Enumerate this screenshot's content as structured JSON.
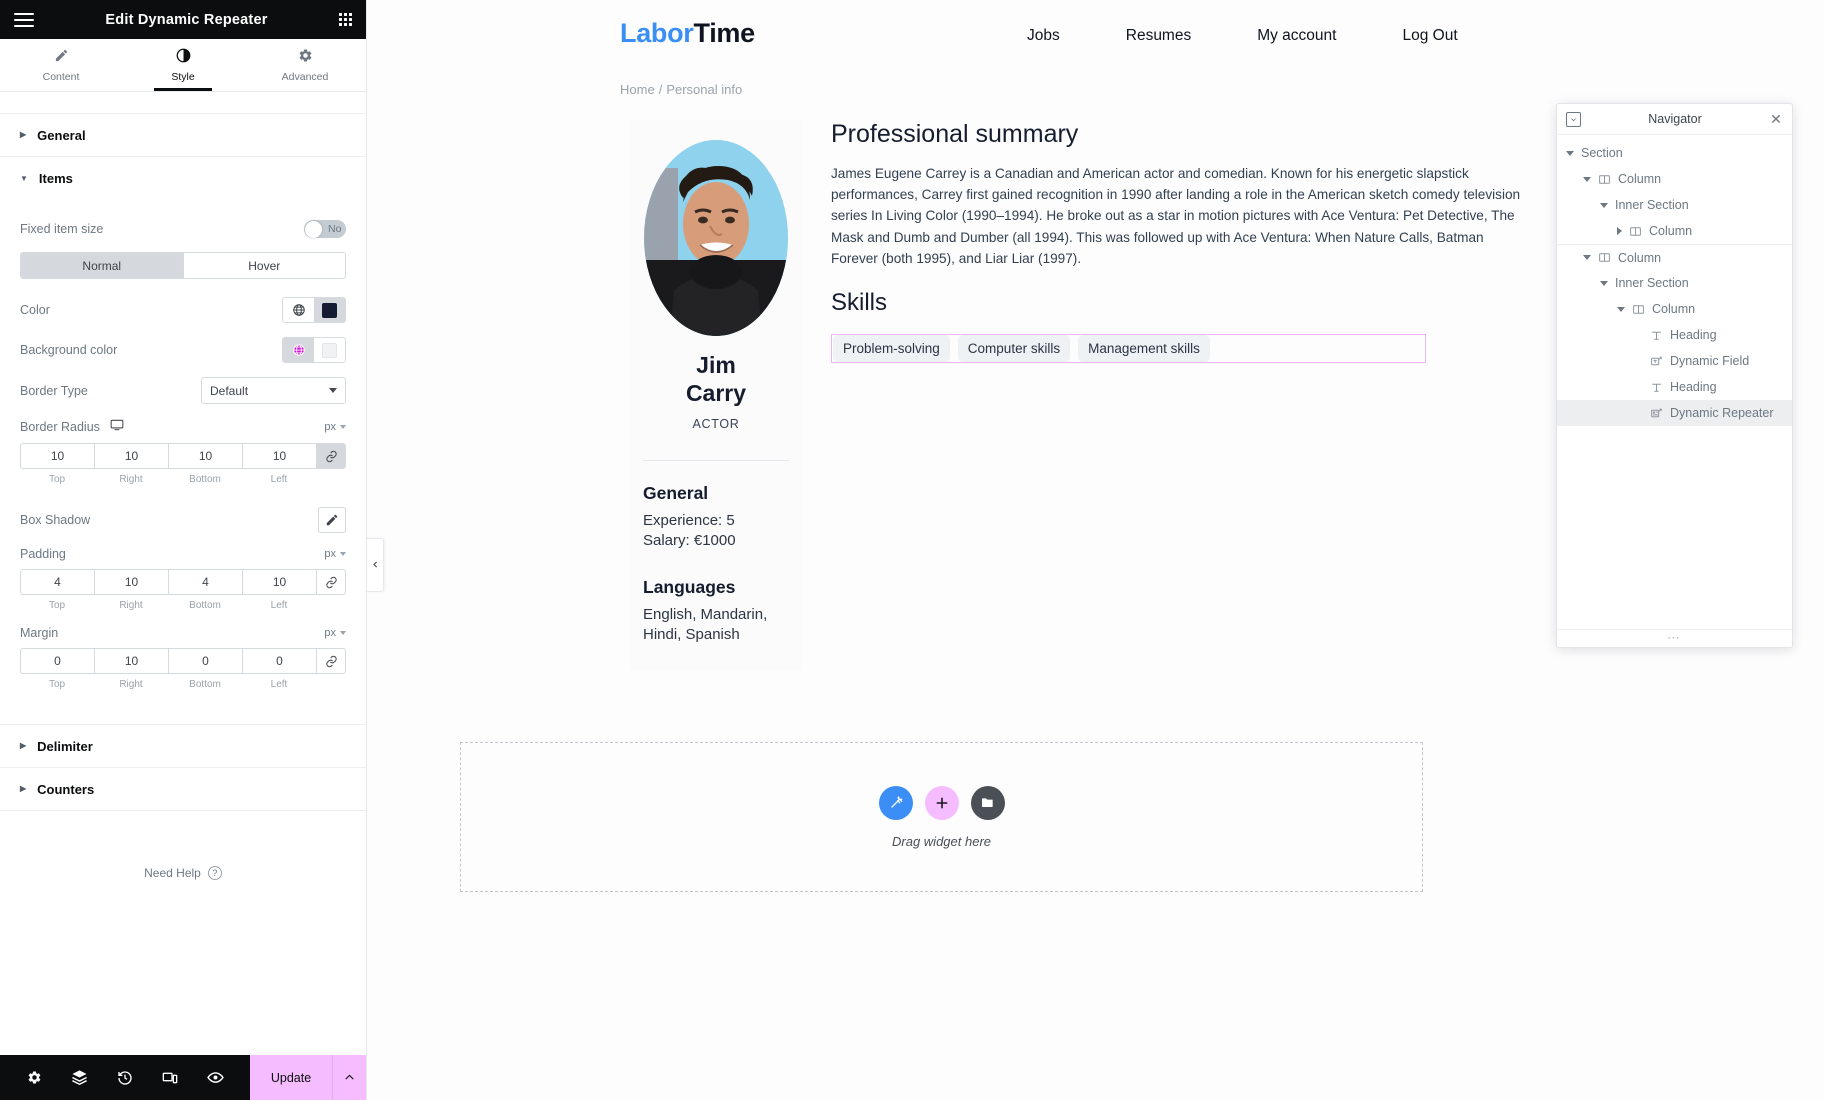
{
  "panel": {
    "title": "Edit Dynamic Repeater",
    "menu_icon": "hamburger-icon",
    "grid_icon": "widgets-grid-icon",
    "tabs": [
      {
        "label": "Content",
        "icon": "pencil-icon",
        "active": false
      },
      {
        "label": "Style",
        "icon": "contrast-icon",
        "active": true
      },
      {
        "label": "Advanced",
        "icon": "gear-icon",
        "active": false
      }
    ],
    "sections": {
      "general": {
        "label": "General",
        "expanded": false
      },
      "items": {
        "label": "Items",
        "expanded": true
      },
      "delimiter": {
        "label": "Delimiter",
        "expanded": false
      },
      "counters": {
        "label": "Counters",
        "expanded": false
      }
    },
    "items": {
      "fixed_item_size": {
        "label": "Fixed item size",
        "value": "No"
      },
      "state_tabs": [
        {
          "label": "Normal",
          "active": true
        },
        {
          "label": "Hover",
          "active": false
        }
      ],
      "color": {
        "label": "Color",
        "swatch": "#141b33",
        "globe_icon": "globe-icon"
      },
      "background_color": {
        "label": "Background color",
        "swatch": "#f1f2f3",
        "globe_icon": "globe-icon",
        "globe_color": "#d408d4"
      },
      "border_type": {
        "label": "Border Type",
        "value": "Default"
      },
      "border_radius": {
        "label": "Border Radius",
        "unit": "px",
        "device_icon": "desktop-icon",
        "link_icon": "link-icon",
        "linked": true,
        "values": [
          "10",
          "10",
          "10",
          "10"
        ],
        "sides": [
          "Top",
          "Right",
          "Bottom",
          "Left"
        ]
      },
      "box_shadow": {
        "label": "Box Shadow",
        "edit_icon": "pencil-icon"
      },
      "padding": {
        "label": "Padding",
        "unit": "px",
        "link_icon": "link-icon",
        "linked": false,
        "values": [
          "4",
          "10",
          "4",
          "10"
        ],
        "sides": [
          "Top",
          "Right",
          "Bottom",
          "Left"
        ]
      },
      "margin": {
        "label": "Margin",
        "unit": "px",
        "link_icon": "link-icon",
        "linked": false,
        "values": [
          "0",
          "10",
          "0",
          "0"
        ],
        "sides": [
          "Top",
          "Right",
          "Bottom",
          "Left"
        ]
      }
    },
    "need_help": {
      "label": "Need Help",
      "icon": "question-circle-icon"
    },
    "footer": {
      "icons": [
        "gear-icon",
        "layers-icon",
        "history-icon",
        "responsive-icon",
        "preview-eye-icon"
      ],
      "update_label": "Update",
      "arrow_icon": "chevron-up-icon"
    },
    "collapse_icon": "chevron-left-icon"
  },
  "site": {
    "logo": {
      "first": "Labor",
      "second": "Time",
      "first_color": "#3a8ef6"
    },
    "nav": [
      "Jobs",
      "Resumes",
      "My account",
      "Log Out"
    ],
    "breadcrumb": {
      "home": "Home",
      "separator": "/",
      "current": "Personal info"
    }
  },
  "resume": {
    "avatar_alt": "jim-carrey-portrait",
    "name_line1": "Jim",
    "name_line2": "Carry",
    "role": "ACTOR",
    "general_title": "General",
    "general_lines": [
      "Experience: 5",
      "Salary: €1000"
    ],
    "languages_title": "Languages",
    "languages_lines": [
      "English, Mandarin,",
      "Hindi, Spanish"
    ],
    "summary_title": "Professional summary",
    "summary_text": "James Eugene Carrey is a Canadian and American actor and comedian. Known for his energetic slapstick performances, Carrey first gained recognition in 1990 after landing a role in the American sketch comedy television series In Living Color (1990–1994). He broke out as a star in motion pictures with Ace Ventura: Pet Detective, The Mask and Dumb and Dumber (all 1994). This was followed up with Ace Ventura: When Nature Calls, Batman Forever (both 1995), and Liar Liar (1997).",
    "skills_title": "Skills",
    "skills": [
      "Problem-solving",
      "Computer skills",
      "Management skills"
    ],
    "selection_color": "#e9b6ef"
  },
  "dropzone": {
    "text": "Drag widget here",
    "buttons": [
      {
        "icon": "magic-wand-icon",
        "color": "#3a8ef6"
      },
      {
        "icon": "plus-icon",
        "color": "#f5bdff"
      },
      {
        "icon": "folder-icon",
        "color": "#4a5056"
      }
    ]
  },
  "navigator": {
    "title": "Navigator",
    "dock_icon": "dock-icon",
    "close_icon": "close-icon",
    "resize_icon": "resize-dots-icon",
    "tree": [
      {
        "label": "Section",
        "indent": 0,
        "toggle": "down",
        "icon": null,
        "selected": false,
        "rule_top": false
      },
      {
        "label": "Column",
        "indent": 1,
        "toggle": "down",
        "icon": "column-icon",
        "selected": false,
        "rule_top": false
      },
      {
        "label": "Inner Section",
        "indent": 2,
        "toggle": "down",
        "icon": null,
        "selected": false,
        "rule_top": false
      },
      {
        "label": "Column",
        "indent": 3,
        "toggle": "right",
        "icon": "column-icon",
        "selected": false,
        "rule_top": false
      },
      {
        "label": "Column",
        "indent": 1,
        "toggle": "down",
        "icon": "column-icon",
        "selected": false,
        "rule_top": true
      },
      {
        "label": "Inner Section",
        "indent": 2,
        "toggle": "down",
        "icon": null,
        "selected": false,
        "rule_top": false
      },
      {
        "label": "Column",
        "indent": 3,
        "toggle": "down",
        "icon": "column-icon",
        "selected": false,
        "rule_top": false
      },
      {
        "label": "Heading",
        "indent": 4,
        "toggle": "none",
        "icon": "heading-icon",
        "selected": false,
        "rule_top": false
      },
      {
        "label": "Dynamic Field",
        "indent": 4,
        "toggle": "none",
        "icon": "dynamic-field-icon",
        "selected": false,
        "rule_top": false
      },
      {
        "label": "Heading",
        "indent": 4,
        "toggle": "none",
        "icon": "heading-icon",
        "selected": false,
        "rule_top": false
      },
      {
        "label": "Dynamic Repeater",
        "indent": 4,
        "toggle": "none",
        "icon": "dynamic-repeater-icon",
        "selected": true,
        "rule_top": false
      }
    ]
  }
}
